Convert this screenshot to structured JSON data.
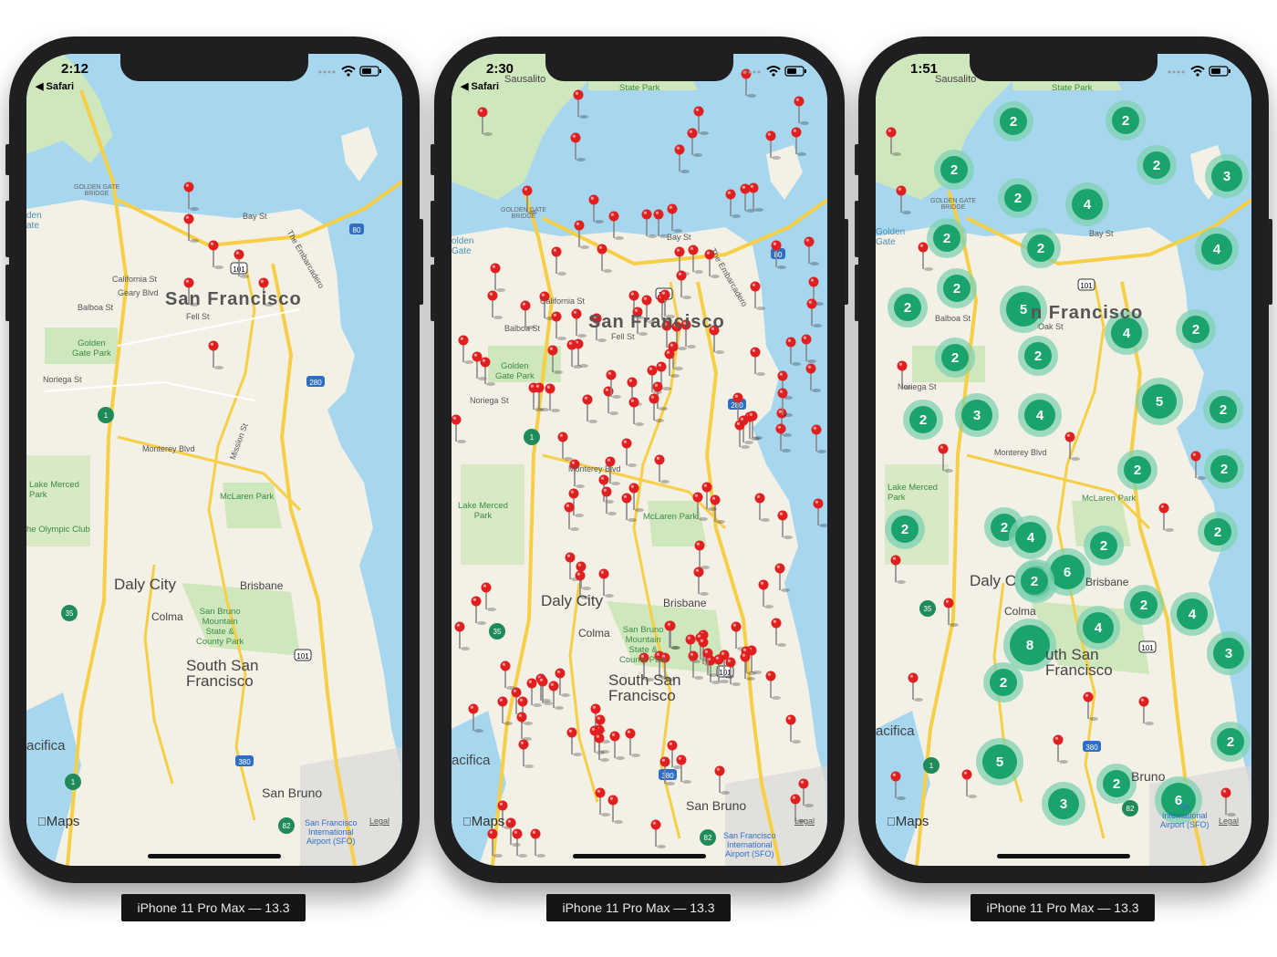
{
  "devices": [
    {
      "time": "2:12",
      "back_label": "◀ Safari",
      "map_labels": {
        "city": "San Francisco",
        "daly": "Daly City",
        "ssf": "South San\nFrancisco",
        "brisbane": "Brisbane",
        "colma": "Colma",
        "sanbruno": "San Bruno",
        "pacifica": "acifica",
        "goldengate": "Golden\nGate Park",
        "mclaren": "McLaren Park",
        "lakemerced": "Lake Merced\nPark",
        "sbm": "San Bruno\nMountain\nState &\nCounty Park",
        "olympic": "he Olympic Club",
        "sfo": "San Francisco\nInternational\nAirport (SFO)",
        "ggbridge": "GOLDEN GATE\nBRIDGE",
        "bay": "Bay St",
        "california": "California St",
        "geary": "Geary Blvd",
        "balboa": "Balboa St",
        "fell": "Fell St",
        "noriega": "Noriega St",
        "monterey": "Monterey Blvd",
        "mission": "Mission St",
        "embarcadero": "The Embarcadero",
        "gate": "den\nate"
      },
      "maps_logo": "Maps",
      "legal": "Legal",
      "caption": "iPhone 11 Pro Max — 13.3"
    },
    {
      "time": "2:30",
      "back_label": "◀ Safari",
      "map_labels": {
        "city": "San Francisco",
        "daly": "Daly City",
        "ssf": "South San\nFrancisco",
        "brisbane": "Brisbane",
        "colma": "Colma",
        "sanbruno": "San Bruno",
        "pacifica": "acifica",
        "goldengate": "Golden\nGate Park",
        "mclaren": "McLaren Park",
        "lakemerced": "Lake Merced\nPark",
        "sbm": "San Bruno\nMountain\nState &\nCounty Park",
        "sausalito": "Sausalito",
        "statepark": "State Park",
        "sfo": "San Francisco\nInternational\nAirport (SFO)",
        "ggbridge": "GOLDEN GATE\nBRIDGE",
        "bay": "Bay St",
        "california": "California St",
        "balboa": "Balboa St",
        "fell": "Fell St",
        "noriega": "Noriega St",
        "monterey": "Monterey Blvd",
        "embarcadero": "The Embarcadero",
        "gate": "olden\nGate"
      },
      "maps_logo": "Maps",
      "legal": "Legal",
      "caption": "iPhone 11 Pro Max — 13.3"
    },
    {
      "time": "1:51",
      "back_label": "",
      "map_labels": {
        "city": "n Francisco",
        "daly": "Daly C",
        "ssf": "uth San\nFrancisco",
        "brisbane": "Brisbane",
        "colma": "Colma",
        "sanbruno": "Bruno",
        "pacifica": "acifica",
        "mclaren": "McLaren Park",
        "lakemerced": "Lake Merced\nPark",
        "sausalito": "Sausalito",
        "statepark": "State Park",
        "ggbridge": "GOLDEN GATE\nBRIDGE",
        "bay": "Bay St",
        "balboa": "Balboa St",
        "oak": "Oak St",
        "noriega": "Noriega St",
        "monterey": "Monterey Blvd",
        "gate": "Golden\nGate",
        "sfo": "Sa\nInternational\nAirport (SFO)"
      },
      "maps_logo": "Maps",
      "legal": "Legal",
      "caption": "iPhone 11 Pro Max — 13.3",
      "clusters": [
        "2",
        "2",
        "2",
        "2",
        "3",
        "2",
        "4",
        "2",
        "2",
        "4",
        "2",
        "2",
        "5",
        "4",
        "2",
        "2",
        "2",
        "2",
        "3",
        "4",
        "5",
        "2",
        "2",
        "2",
        "2",
        "2",
        "4",
        "2",
        "2",
        "3",
        "6",
        "2",
        "2",
        "4",
        "4",
        "8",
        "3",
        "2",
        "5",
        "3",
        "2",
        "2",
        "6"
      ]
    }
  ],
  "icons": {
    "wifi": "wifi-icon",
    "battery": "battery-icon",
    "signal": "signal-dots-icon",
    "apple": "apple-logo-icon",
    "pin": "map-pin-icon",
    "airport": "airport-icon",
    "park": "park-icon"
  },
  "colors": {
    "water": "#a6d7ee",
    "land": "#f3f0e6",
    "park": "#cfe7bd",
    "highway": "#f6cf46",
    "pin": "#e02020",
    "cluster": "#1aa36d",
    "cluster_halo": "#7fd2b2"
  }
}
